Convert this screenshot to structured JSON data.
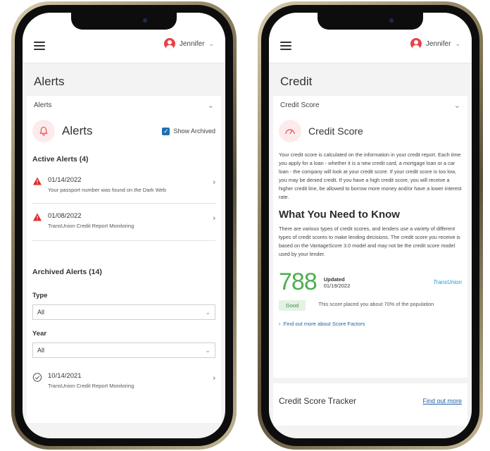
{
  "user": {
    "name": "Jennifer"
  },
  "alerts_screen": {
    "page_title": "Alerts",
    "dropdown_value": "Alerts",
    "card_title": "Alerts",
    "show_archived_label": "Show Archived",
    "show_archived_checked": true,
    "active_title": "Active Alerts (4)",
    "active_alerts": [
      {
        "date": "01/14/2022",
        "description": "Your passport number was found on the Dark Web"
      },
      {
        "date": "01/08/2022",
        "description": "TransUnion Credit Report Monitoring"
      }
    ],
    "archived_title": "Archived Alerts (14)",
    "type_label": "Type",
    "type_value": "All",
    "year_label": "Year",
    "year_value": "All",
    "archived_alerts": [
      {
        "date": "10/14/2021",
        "description": "TransUnion Credit Report Monitoring"
      }
    ]
  },
  "credit_screen": {
    "page_title": "Credit",
    "dropdown_value": "Credit Score",
    "card_title": "Credit Score",
    "intro": "Your credit score is calculated on the information in your credit report. Each time you apply for a loan - whether it is a new credit card, a mortgage loan or a car loan - the company will look at your credit score. If your credit score is too low, you may be denied credit. If you have a high credit score, you will receive a higher credit line, be allowed to borrow more money and/or have a lower interest rate.",
    "know_title": "What You Need to Know",
    "know_text": "There are various types of credit scores, and lenders use a variety of different types of credit scores to make lending decisions. The credit score you receive is based on the VantageScore 3.0 model and may not be the credit score model used by your lender.",
    "score": "788",
    "updated_label": "Updated",
    "updated_date": "01/19/2022",
    "bureau": "TransUnion",
    "rating": "Good",
    "rating_text": "This score placed you about 70% of the population",
    "factors_link": "Find out more about Score Factors",
    "tracker_title": "Credit Score Tracker",
    "tracker_link": "Find out more"
  },
  "colors": {
    "accent_red": "#e8424a",
    "score_green": "#4caf50",
    "link_blue": "#1f5fa8",
    "check_blue": "#1f6fb2"
  },
  "icons": [
    "menu-icon",
    "avatar-icon",
    "chevron-down-icon",
    "bell-icon",
    "checkbox-icon",
    "warning-icon",
    "chevron-right-icon",
    "check-circle-icon",
    "gauge-icon"
  ]
}
